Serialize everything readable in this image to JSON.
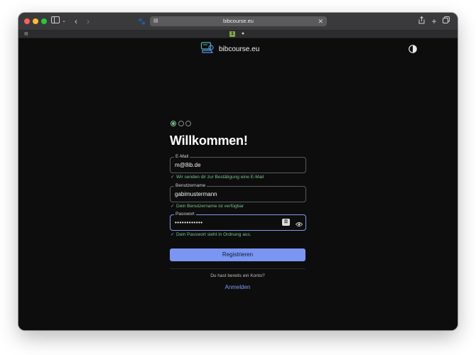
{
  "browser": {
    "url": "bibcourse.eu",
    "favorites": [
      "fav-app",
      "apple"
    ]
  },
  "header": {
    "site_name": "bibcourse.eu"
  },
  "steps": {
    "total": 3,
    "current": 1
  },
  "form": {
    "title": "Willkommen!",
    "email": {
      "label": "E-Mail",
      "value": "m@8ib.de",
      "hint": "Wir senden dir zur Bestätigung eine E-Mail"
    },
    "username": {
      "label": "Benutzername",
      "value": "gabimustermann",
      "hint": "Dein Benutzername ist verfügbar"
    },
    "password": {
      "label": "Passwort",
      "value": "••••••••••••",
      "hint": "Dein Passwort sieht in Ordnung aus."
    },
    "submit_label": "Registrieren",
    "account_question": "Du hast bereits ein Konto?",
    "login_label": "Anmelden"
  },
  "colors": {
    "accent": "#7a96f2",
    "success": "#7bc18a",
    "background": "#0d0d0d"
  }
}
